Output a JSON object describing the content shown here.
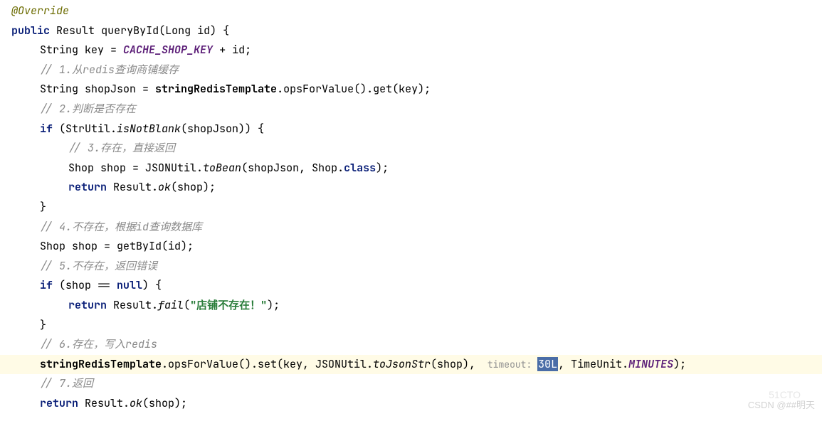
{
  "l1": {
    "a": "@Override"
  },
  "l2": {
    "kw": "public",
    "t": "Result",
    "m": "queryById",
    "p": "Long id",
    "b": " {"
  },
  "l3": {
    "t": "String",
    "v": "key = ",
    "c": "CACHE_SHOP_KEY",
    "r": " + id;"
  },
  "c1": "// 1.从redis查询商铺缓存",
  "l5": {
    "t": "String",
    "v": "shopJson = ",
    "f": "stringRedisTemplate",
    "r": ".opsForValue().get(key);"
  },
  "c2": "// 2.判断是否存在",
  "l7": {
    "kw": "if",
    "p1": " (StrUtil.",
    "m": "isNotBlank",
    "p2": "(shopJson)) {"
  },
  "c3": "// 3.存在，直接返回",
  "l9": {
    "t": "Shop",
    "v": "shop = JSONUtil.",
    "m": "toBean",
    "p": "(shopJson, Shop.",
    "kw": "class",
    "r": ");"
  },
  "l10": {
    "kw": "return",
    "t": " Result.",
    "m": "ok",
    "r": "(shop);"
  },
  "l11": "}",
  "c4": "// 4.不存在，根据id查询数据库",
  "l13": {
    "t": "Shop",
    "v": "shop = getById(id);"
  },
  "c5": "// 5.不存在，返回错误",
  "l15": {
    "kw": "if",
    "p": " (shop == ",
    "n": "null",
    "r": ") {"
  },
  "l16": {
    "kw": "return",
    "t": " Result.",
    "m": "fail",
    "p": "(",
    "s": "\"店铺不存在！\"",
    "r": ");"
  },
  "l17": "}",
  "c6": "// 6.存在，写入redis",
  "l19": {
    "f": "stringRedisTemplate",
    "a": ".opsForValue().set(key, JSONUtil.",
    "m": "toJsonStr",
    "b": "(shop), ",
    "hint": " timeout: ",
    "val": "30L",
    "c": ", TimeUnit.",
    "mi": "MINUTES",
    "r": ");"
  },
  "c7": "// 7.返回",
  "l21": {
    "kw": "return",
    "t": " Result.",
    "m": "ok",
    "r": "(shop);"
  },
  "wm1": "CSDN @##明天",
  "wm2": "51CTO"
}
